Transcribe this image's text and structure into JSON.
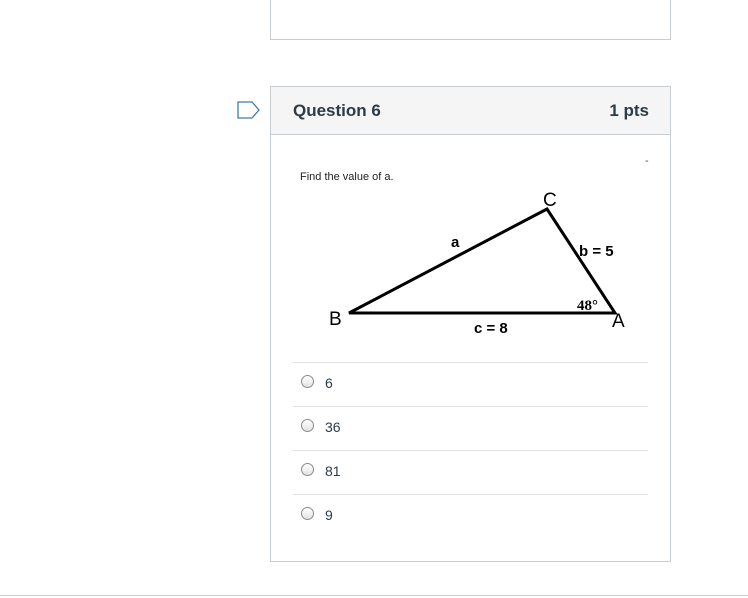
{
  "question": {
    "title": "Question 6",
    "points": "1 pts",
    "text": "Find the value of a.",
    "corner_mark": "-"
  },
  "figure": {
    "vertices": {
      "a": "A",
      "b": "B",
      "c": "C"
    },
    "side_labels": {
      "a": "a",
      "b": "b = 5",
      "c": "c = 8"
    },
    "angle_label": "48°"
  },
  "answers": [
    {
      "label": "6"
    },
    {
      "label": "36"
    },
    {
      "label": "81"
    },
    {
      "label": "9"
    }
  ],
  "icons": {
    "flag": "bookmark-flag-icon",
    "radio": "radio-button-icon"
  },
  "colors": {
    "flag": "#3d7ea6",
    "header_bg": "#f5f5f5",
    "border": "#c7cdd1"
  }
}
